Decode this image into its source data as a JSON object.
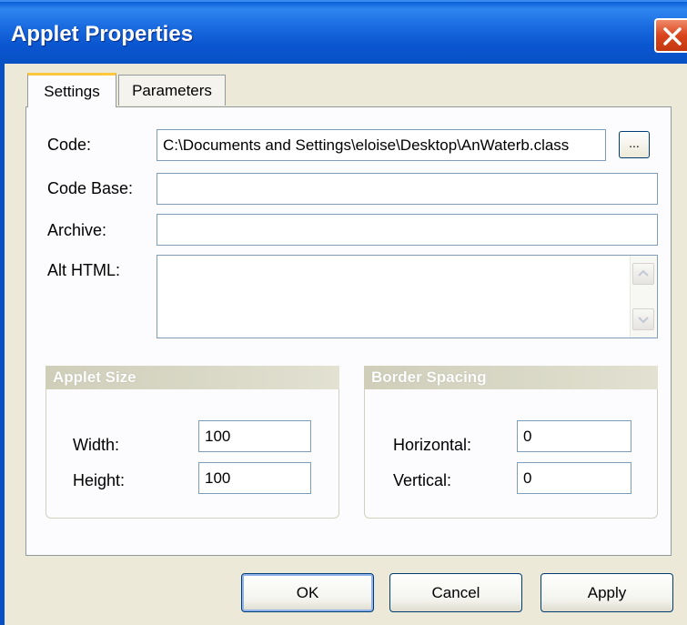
{
  "window": {
    "title": "Applet Properties"
  },
  "tabs": [
    {
      "label": "Settings",
      "active": true
    },
    {
      "label": "Parameters",
      "active": false
    }
  ],
  "settings": {
    "code_label": "Code:",
    "code_value": "C:\\Documents and Settings\\eloise\\Desktop\\AnWaterb.class",
    "browse_label": "...",
    "codebase_label": "Code Base:",
    "codebase_value": "",
    "archive_label": "Archive:",
    "archive_value": "",
    "althtml_label": "Alt HTML:",
    "althtml_value": ""
  },
  "applet_size": {
    "header": "Applet Size",
    "width_label": "Width:",
    "width_value": "100",
    "height_label": "Height:",
    "height_value": "100"
  },
  "border_spacing": {
    "header": "Border Spacing",
    "horizontal_label": "Horizontal:",
    "horizontal_value": "0",
    "vertical_label": "Vertical:",
    "vertical_value": "0"
  },
  "buttons": {
    "ok": "OK",
    "cancel": "Cancel",
    "apply": "Apply"
  },
  "icons": {
    "close": "close-icon",
    "scroll_up": "scroll-up-icon",
    "scroll_down": "scroll-down-icon"
  },
  "colors": {
    "titlebar": "#0a56d0",
    "close": "#d9451c",
    "tab_highlight": "#ffc83c"
  }
}
